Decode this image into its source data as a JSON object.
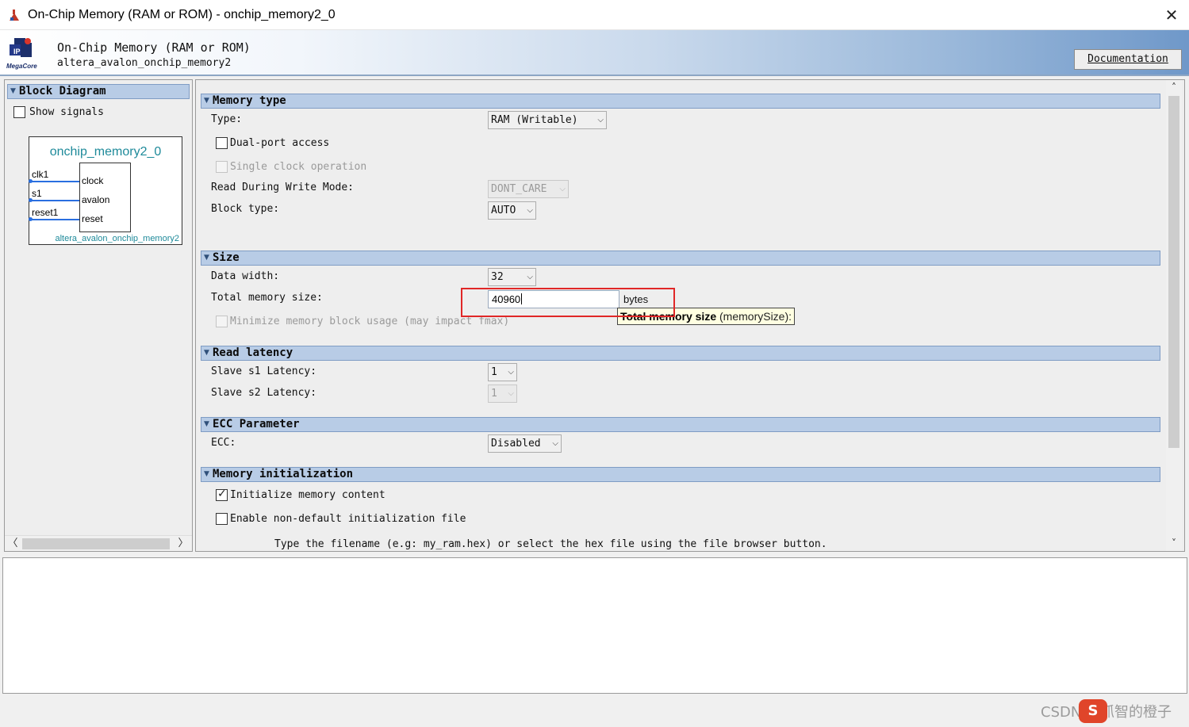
{
  "window": {
    "title": "On-Chip Memory (RAM or ROM) - onchip_memory2_0",
    "close_glyph": "✕"
  },
  "header": {
    "component_name": "On-Chip Memory (RAM or ROM)",
    "component_class": "altera_avalon_onchip_memory2",
    "logo_text": "MegaCore",
    "documentation_label": "Documentation"
  },
  "left_panel": {
    "section_title": "Block Diagram",
    "show_signals_label": "Show signals",
    "diagram": {
      "instance_name": "onchip_memory2_0",
      "class_name": "altera_avalon_onchip_memory2",
      "ports_left": [
        "clk1",
        "s1",
        "reset1"
      ],
      "ports_right": [
        "clock",
        "avalon",
        "reset"
      ]
    }
  },
  "memory_type": {
    "section_title": "Memory type",
    "type_label": "Type:",
    "type_value": "RAM (Writable)",
    "dual_port_label": "Dual-port access",
    "single_clock_label": "Single clock operation",
    "rdw_label": "Read During Write Mode:",
    "rdw_value": "DONT_CARE",
    "block_type_label": "Block type:",
    "block_type_value": "AUTO"
  },
  "size": {
    "section_title": "Size",
    "data_width_label": "Data width:",
    "data_width_value": "32",
    "total_size_label": "Total memory size:",
    "total_size_value": "40960",
    "total_size_unit": "bytes",
    "minimize_label": "Minimize memory block usage (may impact fmax)",
    "tooltip_bold": "Total memory size",
    "tooltip_rest": " (memorySize):"
  },
  "read_latency": {
    "section_title": "Read latency",
    "s1_label": "Slave s1 Latency:",
    "s1_value": "1",
    "s2_label": "Slave s2 Latency:",
    "s2_value": "1"
  },
  "ecc": {
    "section_title": "ECC Parameter",
    "ecc_label": "ECC:",
    "ecc_value": "Disabled"
  },
  "memory_init": {
    "section_title": "Memory initialization",
    "init_content_label": "Initialize memory content",
    "init_content_checked": true,
    "non_default_label": "Enable non-default initialization file",
    "hint_text": "Type the filename (e.g: my_ram.hex) or select the hex file using the file browser button."
  },
  "watermark": {
    "text": "CSDN @抓智的橙子",
    "badge": "S"
  },
  "colors": {
    "section_header_bg": "#b8cce6",
    "highlight_box": "#e02727",
    "diagram_text": "#1e8a9a",
    "wire": "#2a6fe0"
  }
}
